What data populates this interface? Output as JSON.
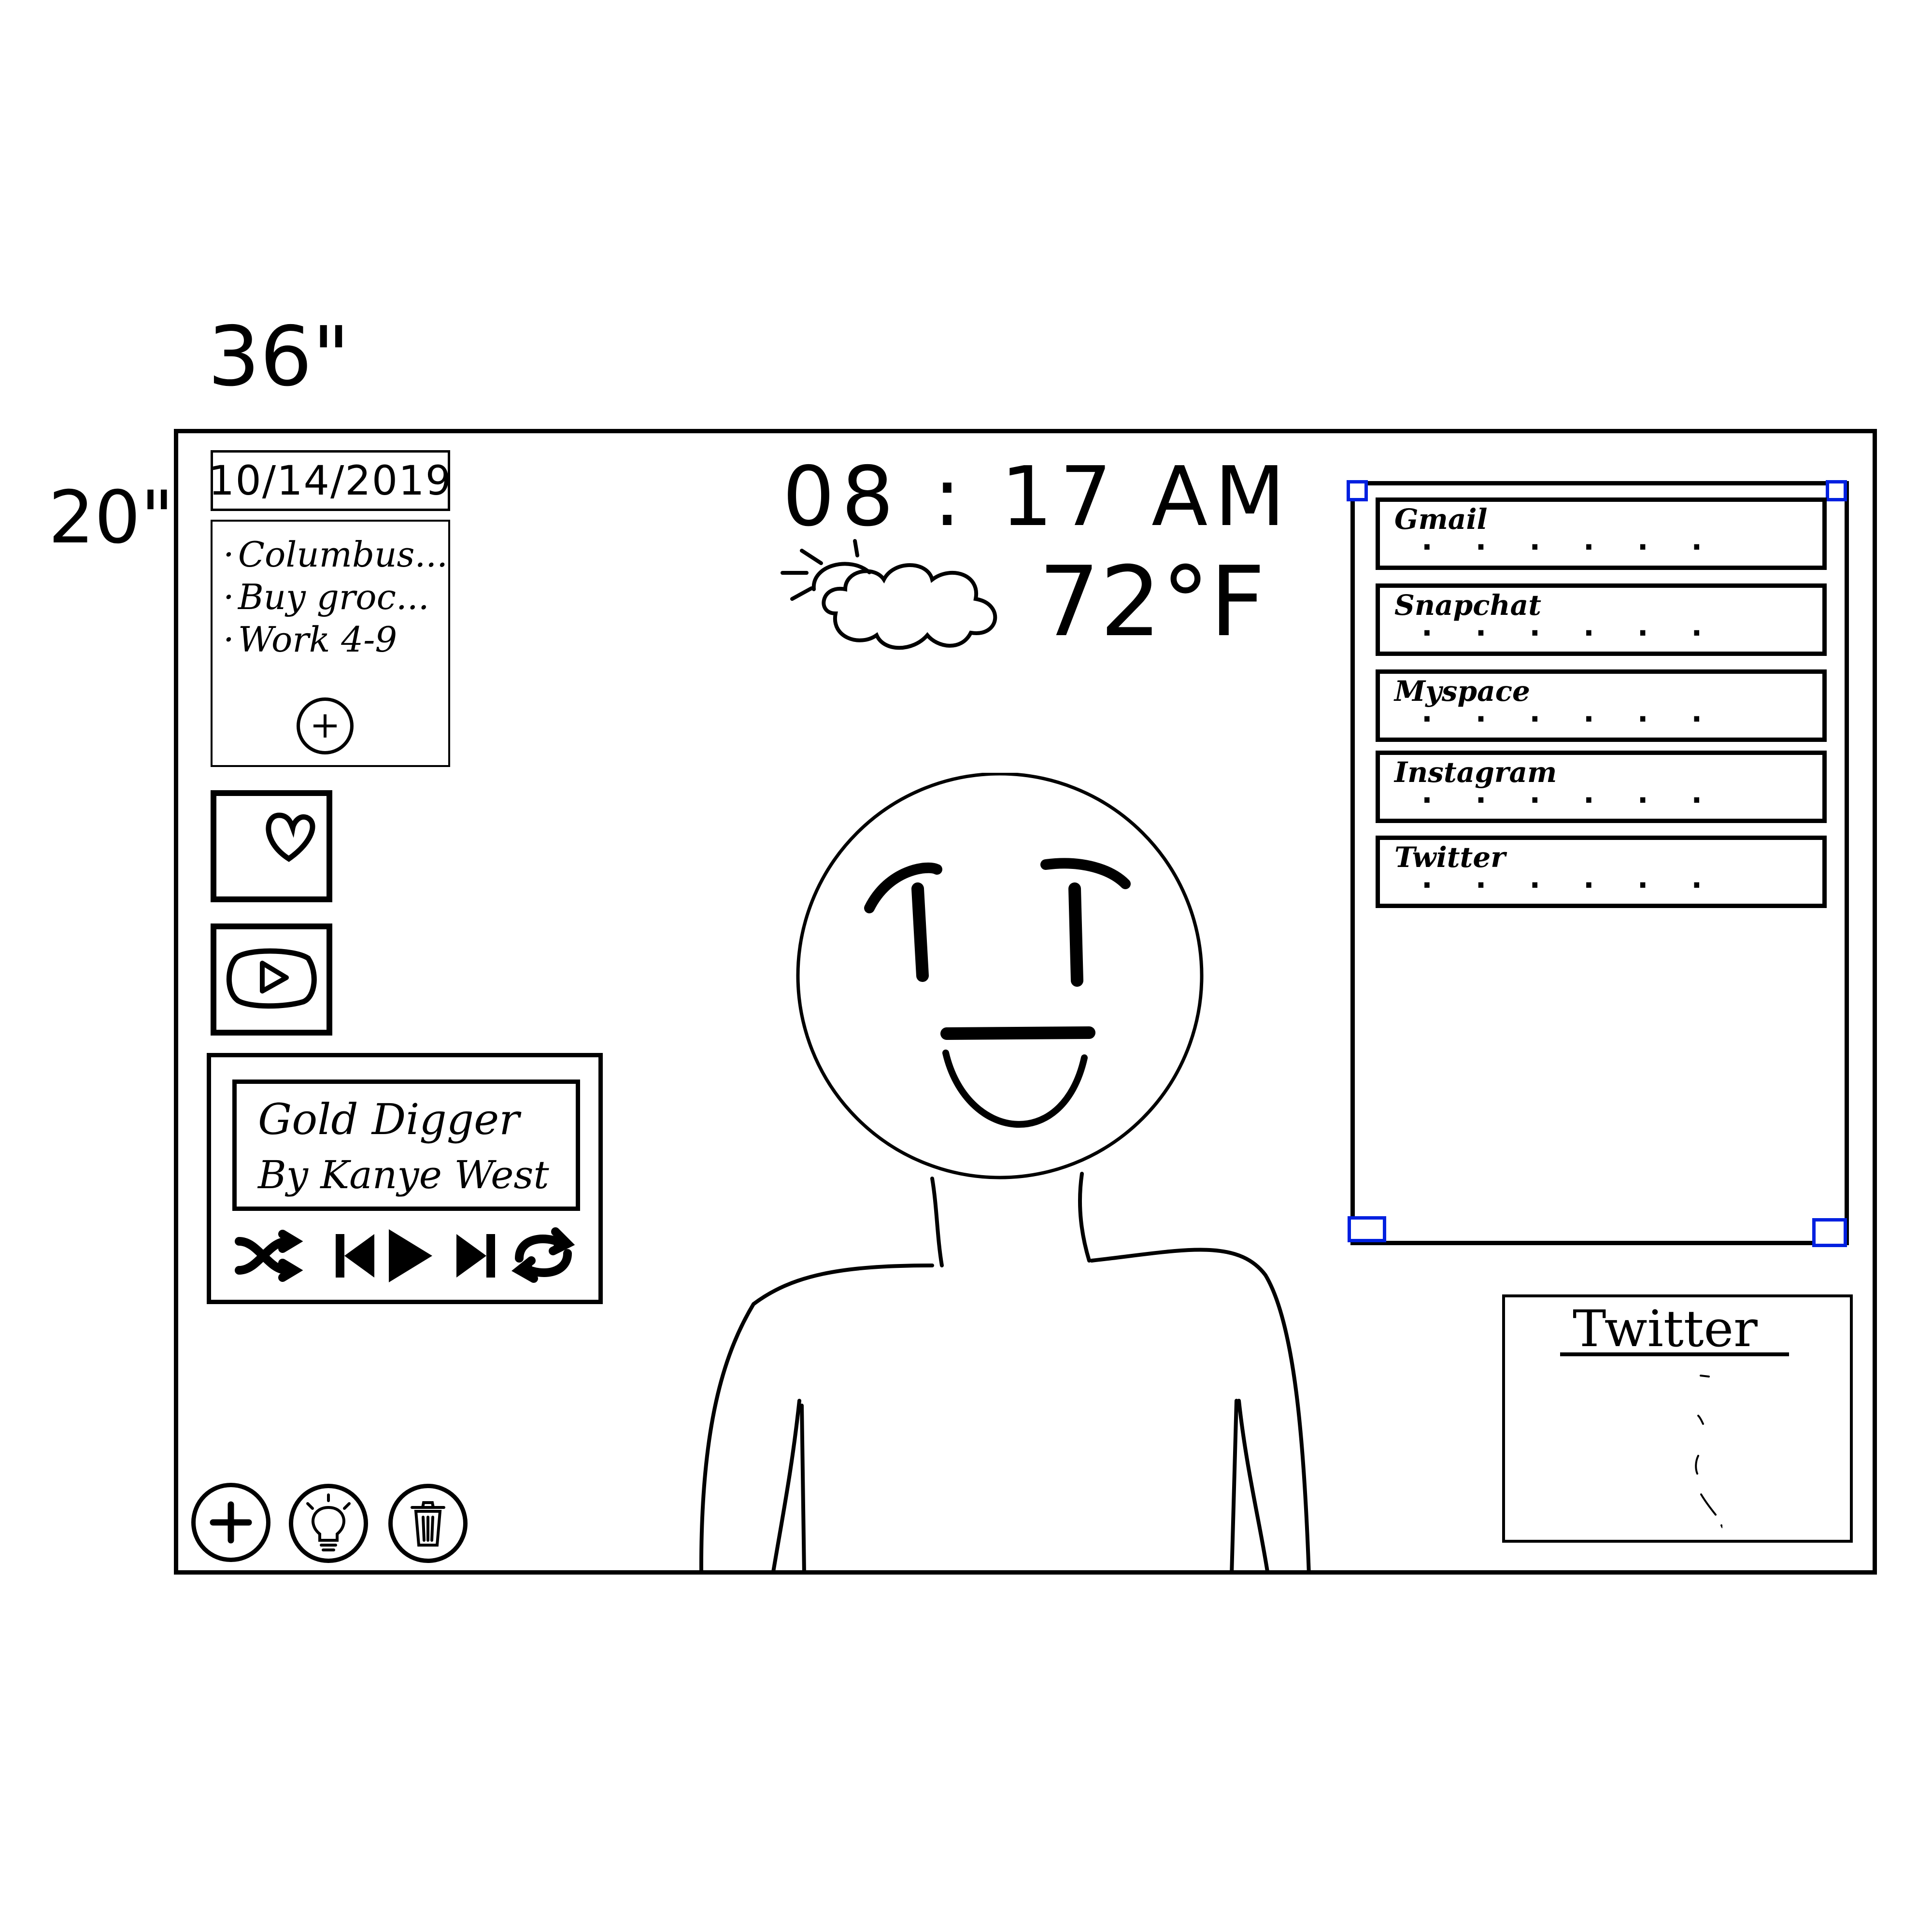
{
  "dimensions": {
    "width_label": "36\"",
    "height_label": "20\""
  },
  "calendar": {
    "date": "10/14/2019",
    "todos": [
      "Columbus...",
      "Buy groc...",
      "Work 4-9"
    ]
  },
  "apps": {
    "favorites_icon": "heart-icon",
    "video_icon": "play-icon"
  },
  "music": {
    "title": "Gold Digger",
    "artist": "By Kanye West",
    "controls": [
      "shuffle-icon",
      "previous-icon",
      "play-icon",
      "next-icon",
      "repeat-icon"
    ]
  },
  "clock": {
    "time": "08 : 17 AM"
  },
  "weather": {
    "icon": "partly-sunny-cloud-icon",
    "temperature": "72°F"
  },
  "notifications": {
    "items": [
      {
        "label": "Gmail",
        "preview": ". . .   .   . ."
      },
      {
        "label": "Snapchat",
        "preview": ". . .   .   . ."
      },
      {
        "label": "Myspace",
        "preview": ". . .   .   . ."
      },
      {
        "label": "Instagram",
        "preview": ". . .   .   . ."
      },
      {
        "label": "Twitter",
        "preview": ". . .   .   . ."
      }
    ],
    "handle_color": "#0020e0"
  },
  "twitter_widget": {
    "title": "Twitter",
    "status_icon": "loading-spinner-icon"
  },
  "actions": {
    "add_icon": "plus-icon",
    "idea_icon": "lightbulb-icon",
    "delete_icon": "trash-icon"
  }
}
